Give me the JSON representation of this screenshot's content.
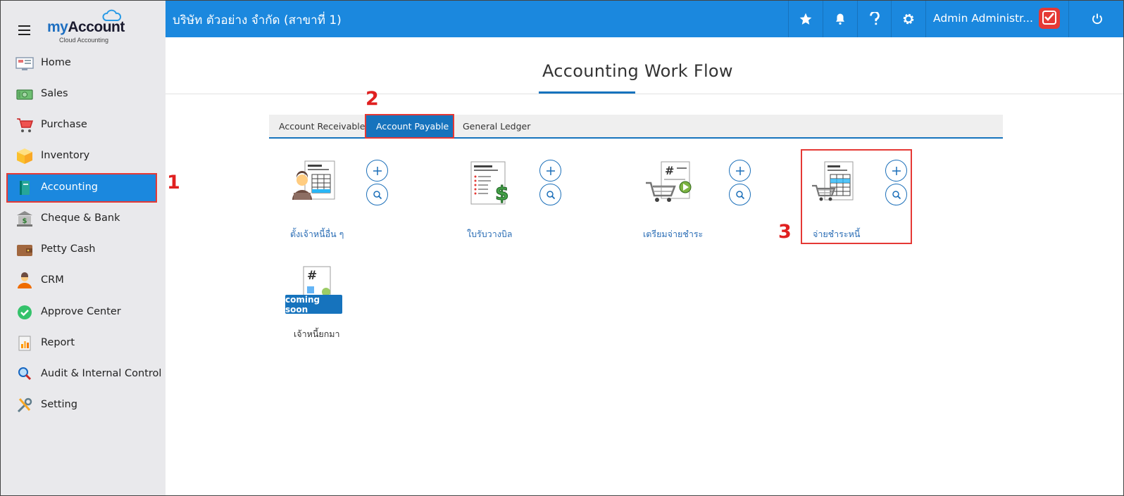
{
  "brand": {
    "name_my": "my",
    "name_account": "Account",
    "subtitle": "Cloud Accounting"
  },
  "sidebar": {
    "items": [
      {
        "label": "Home",
        "icon": "home-monitor-icon"
      },
      {
        "label": "Sales",
        "icon": "cash-icon"
      },
      {
        "label": "Purchase",
        "icon": "shopping-cart-icon"
      },
      {
        "label": "Inventory",
        "icon": "box-icon"
      },
      {
        "label": "Accounting",
        "icon": "ledger-book-icon",
        "active": true
      },
      {
        "label": "Cheque & Bank",
        "icon": "bank-icon"
      },
      {
        "label": "Petty Cash",
        "icon": "wallet-icon"
      },
      {
        "label": "CRM",
        "icon": "person-icon"
      },
      {
        "label": "Approve Center",
        "icon": "check-circle-icon"
      },
      {
        "label": "Report",
        "icon": "report-icon"
      },
      {
        "label": "Audit & Internal Control",
        "icon": "magnifier-icon"
      },
      {
        "label": "Setting",
        "icon": "tools-icon"
      }
    ]
  },
  "topbar": {
    "company": "บริษัท ตัวอย่าง จำกัด (สาขาที่ 1)",
    "user_name": "Admin Administr..."
  },
  "main": {
    "title": "Accounting Work Flow",
    "tabs": [
      {
        "label": "Account Receivable"
      },
      {
        "label": "Account Payable",
        "active": true
      },
      {
        "label": "General Ledger"
      }
    ],
    "cards": [
      {
        "label": "ตั้งเจ้าหนี้อื่น ๆ",
        "icon": "businessman-ledger-icon"
      },
      {
        "label": "ใบรับวางบิล",
        "icon": "invoice-dollar-icon"
      },
      {
        "label": "เตรียมจ่ายชำระ",
        "icon": "cart-payment-icon"
      },
      {
        "label": "จ่ายชำระหนี้",
        "icon": "cart-ledger-icon"
      },
      {
        "label": "เจ้าหนี้ยกมา",
        "icon": "carry-forward-icon",
        "badge": "coming soon"
      }
    ]
  },
  "annotations": {
    "step1": "1",
    "step2": "2",
    "step3": "3"
  },
  "colors": {
    "primary": "#1b88de",
    "dark_primary": "#1673bd",
    "highlight": "#e53935",
    "sidebar_bg": "#e9e9ec"
  }
}
